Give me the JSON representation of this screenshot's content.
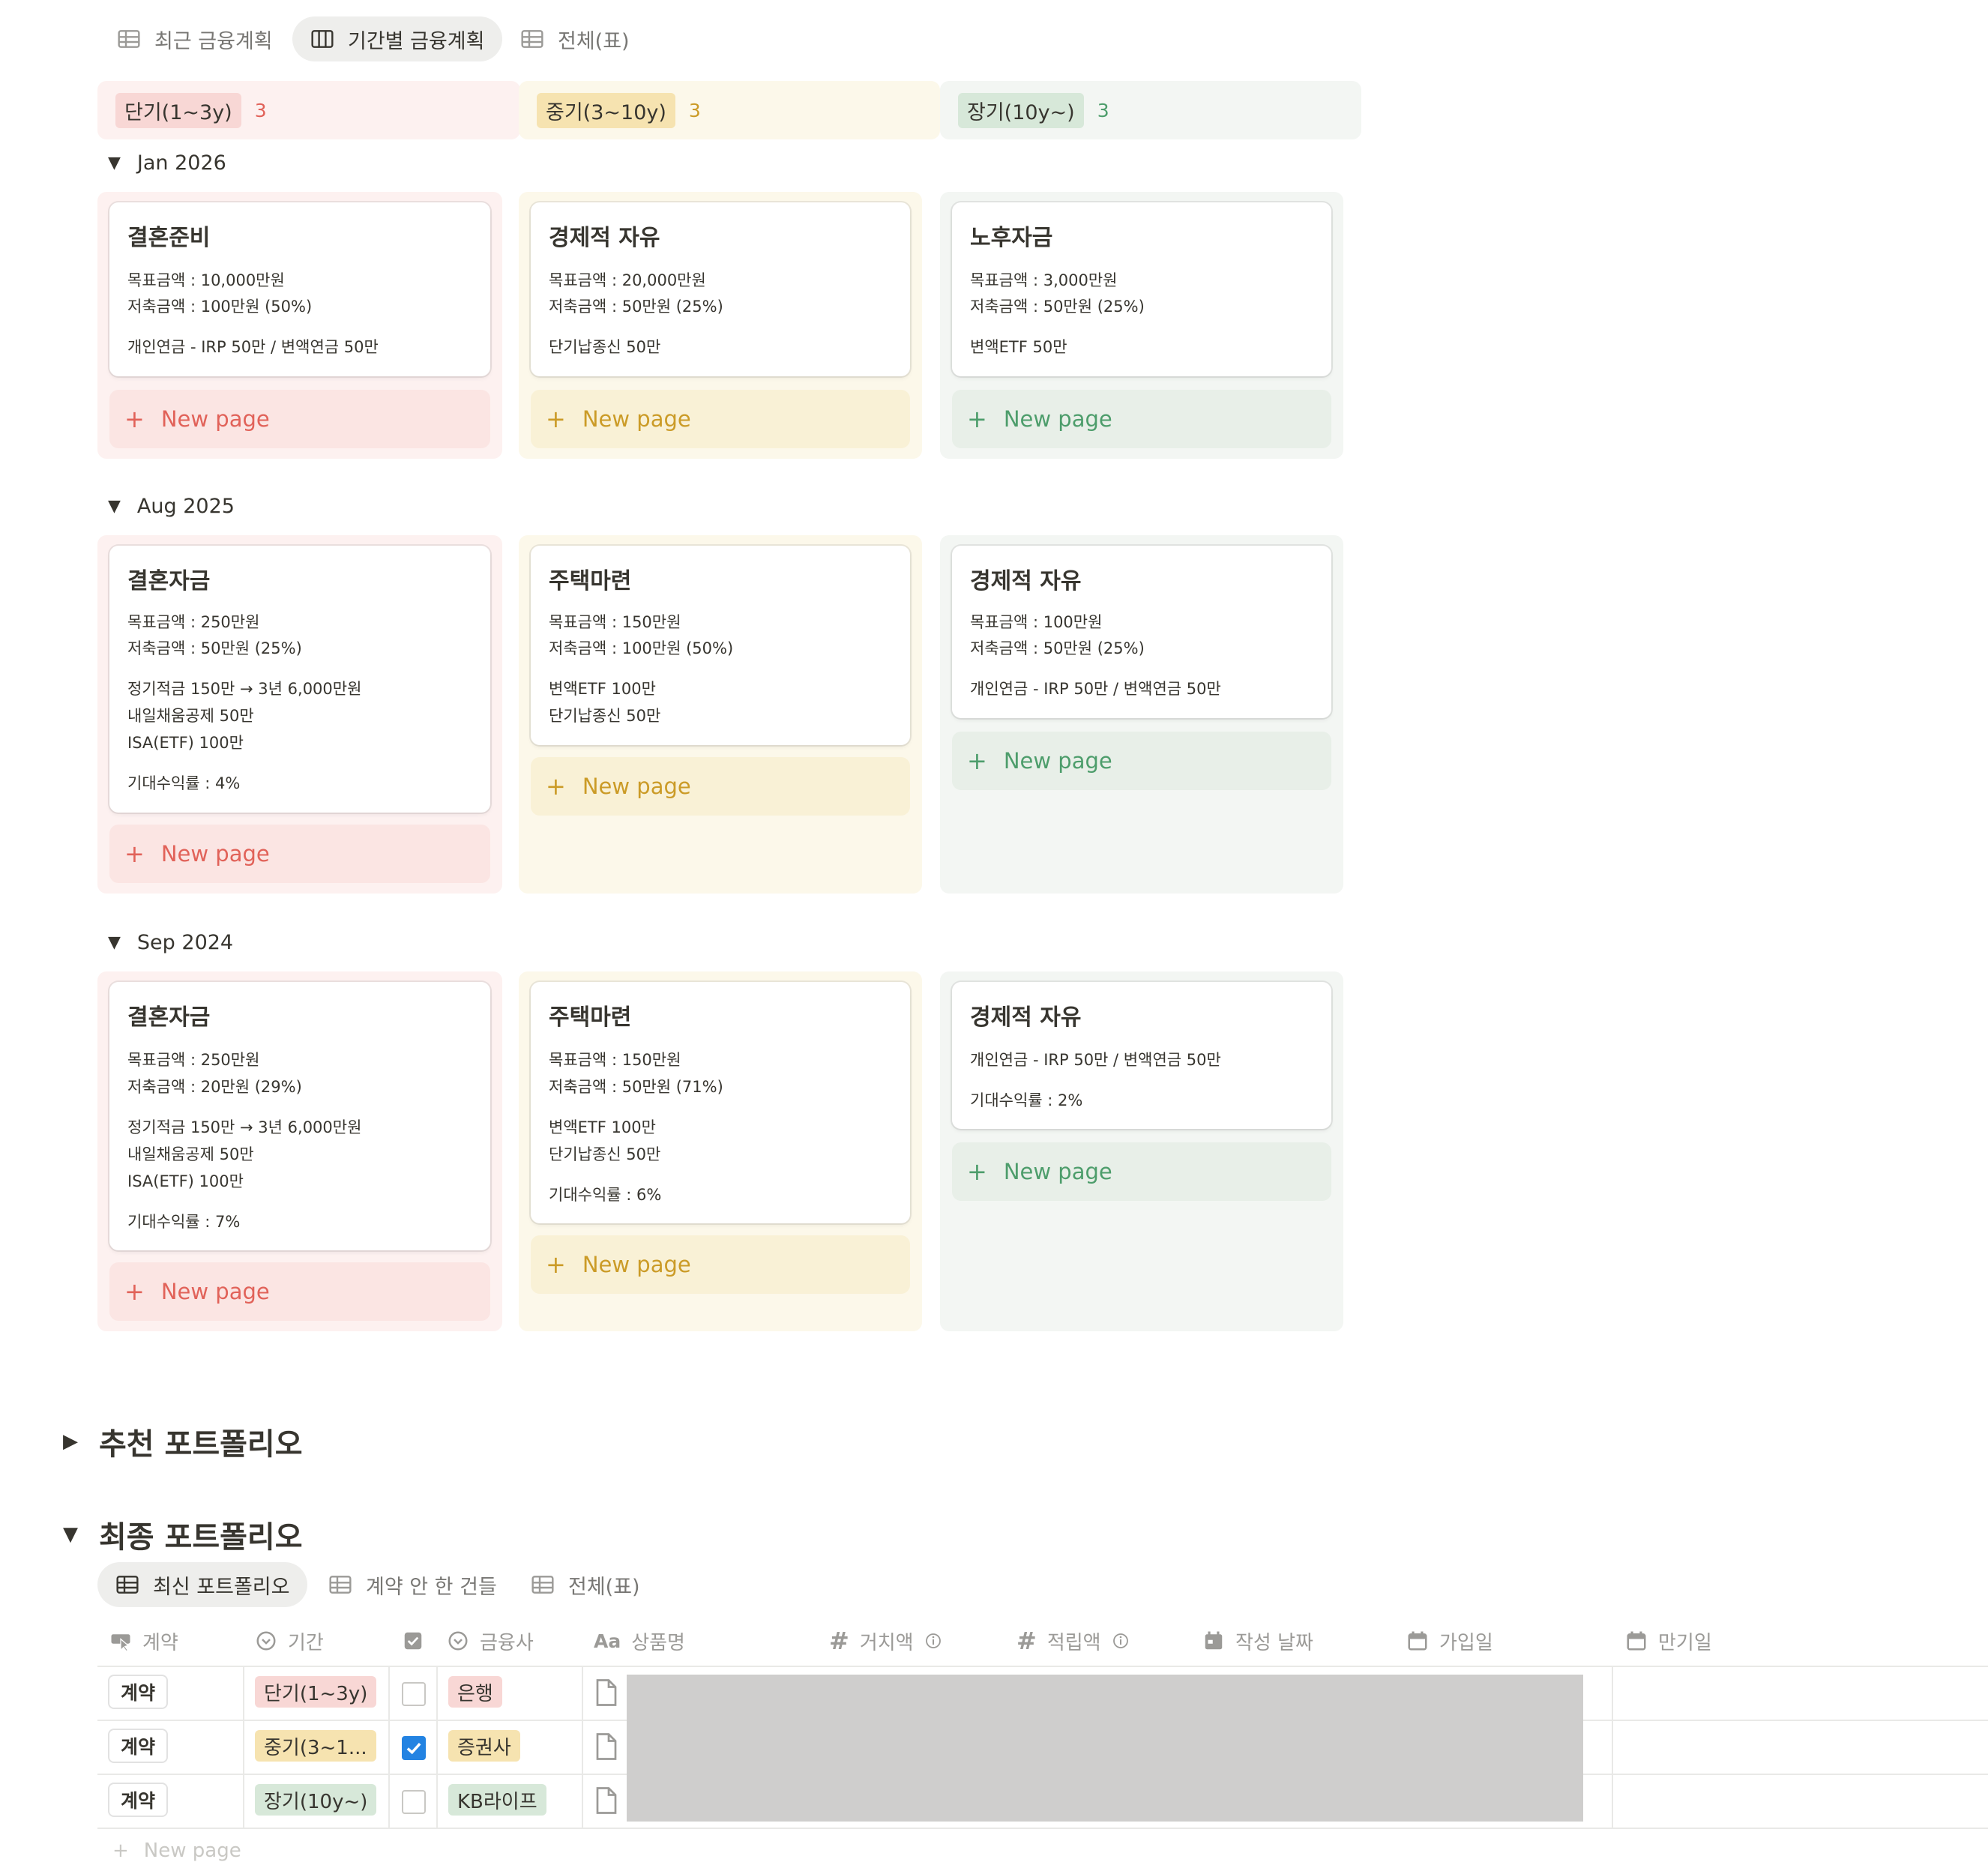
{
  "colors": {
    "red": "#e16259",
    "yellow": "#cb9b27",
    "green": "#4d9d6b",
    "redbg": "#fdebec",
    "yellowbg": "#fbf3db",
    "greenbg": "#edf3ec",
    "blue": "#2383e2"
  },
  "tabs_top": [
    {
      "label": "최근 금융계획",
      "icon": "table-icon"
    },
    {
      "label": "기간별 금융계획",
      "icon": "board-icon"
    },
    {
      "label": "전체(표)",
      "icon": "table-icon"
    }
  ],
  "columns": [
    {
      "label": "단기(1~3y)",
      "count": "3"
    },
    {
      "label": "중기(3~10y)",
      "count": "3"
    },
    {
      "label": "장기(10y~)",
      "count": "3"
    }
  ],
  "new_page_label": "New page",
  "groups": [
    {
      "label": "Jan 2026",
      "cards": [
        {
          "title": "결혼준비",
          "lines": [
            "목표금액 : 10,000만원",
            "저축금액 : 100만원 (50%)",
            "개인연금 - IRP 50만 / 변액연금 50만"
          ]
        },
        {
          "title": "경제적 자유",
          "lines": [
            "목표금액 : 20,000만원",
            "저축금액 : 50만원 (25%)",
            "단기납종신 50만"
          ]
        },
        {
          "title": "노후자금",
          "lines": [
            "목표금액 : 3,000만원",
            "저축금액 : 50만원 (25%)",
            "변액ETF 50만"
          ]
        }
      ]
    },
    {
      "label": "Aug 2025",
      "cards": [
        {
          "title": "결혼자금",
          "lines": [
            "목표금액 : 250만원",
            "저축금액 : 50만원 (25%)",
            "정기적금 150만 → 3년 6,000만원",
            "내일채움공제 50만",
            "ISA(ETF) 100만",
            "기대수익률 : 4%"
          ]
        },
        {
          "title": "주택마련",
          "lines": [
            "목표금액 : 150만원",
            "저축금액 : 100만원 (50%)",
            "변액ETF 100만",
            "단기납종신 50만"
          ]
        },
        {
          "title": "경제적 자유",
          "lines": [
            "목표금액 : 100만원",
            "저축금액 : 50만원 (25%)",
            "개인연금 - IRP 50만 / 변액연금 50만"
          ]
        }
      ]
    },
    {
      "label": "Sep 2024",
      "cards": [
        {
          "title": "결혼자금",
          "lines": [
            "목표금액 : 250만원",
            "저축금액 : 20만원 (29%)",
            "정기적금 150만 → 3년 6,000만원",
            "내일채움공제 50만",
            "ISA(ETF) 100만",
            "기대수익률 : 7%"
          ]
        },
        {
          "title": "주택마련",
          "lines": [
            "목표금액 : 150만원",
            "저축금액 : 50만원 (71%)",
            "변액ETF 100만",
            "단기납종신 50만",
            "기대수익률 : 6%"
          ]
        },
        {
          "title": "경제적 자유",
          "lines": [
            "개인연금 - IRP 50만 / 변액연금 50만",
            "기대수익률 : 2%"
          ]
        }
      ]
    }
  ],
  "sections": {
    "recommended": "추천 포트폴리오",
    "final": "최종 포트폴리오"
  },
  "tabs_bottom": [
    {
      "label": "최신 포트폴리오",
      "icon": "table-icon"
    },
    {
      "label": "계약 안 한 건들",
      "icon": "table-icon"
    },
    {
      "label": "전체(표)",
      "icon": "table-icon"
    }
  ],
  "table": {
    "headers": [
      {
        "label": "계약",
        "icon": "button-icon"
      },
      {
        "label": "기간",
        "icon": "select-icon"
      },
      {
        "label": "",
        "icon": "checkbox-icon"
      },
      {
        "label": "금융사",
        "icon": "select-icon"
      },
      {
        "label": "상품명",
        "icon": "text-icon"
      },
      {
        "label": "거치액",
        "icon": "number-icon"
      },
      {
        "label": "적립액",
        "icon": "number-icon"
      },
      {
        "label": "작성 날짜",
        "icon": "calendar-icon"
      },
      {
        "label": "가입일",
        "icon": "calendar-icon"
      },
      {
        "label": "만기일",
        "icon": "calendar-icon"
      }
    ],
    "rows": [
      {
        "button": "계약",
        "period": "단기(1~3y)",
        "checked": false,
        "company": "은행"
      },
      {
        "button": "계약",
        "period": "중기(3~1...",
        "checked": true,
        "company": "증권사"
      },
      {
        "button": "계약",
        "period": "장기(10y~)",
        "checked": false,
        "company": "KB라이프"
      }
    ]
  }
}
